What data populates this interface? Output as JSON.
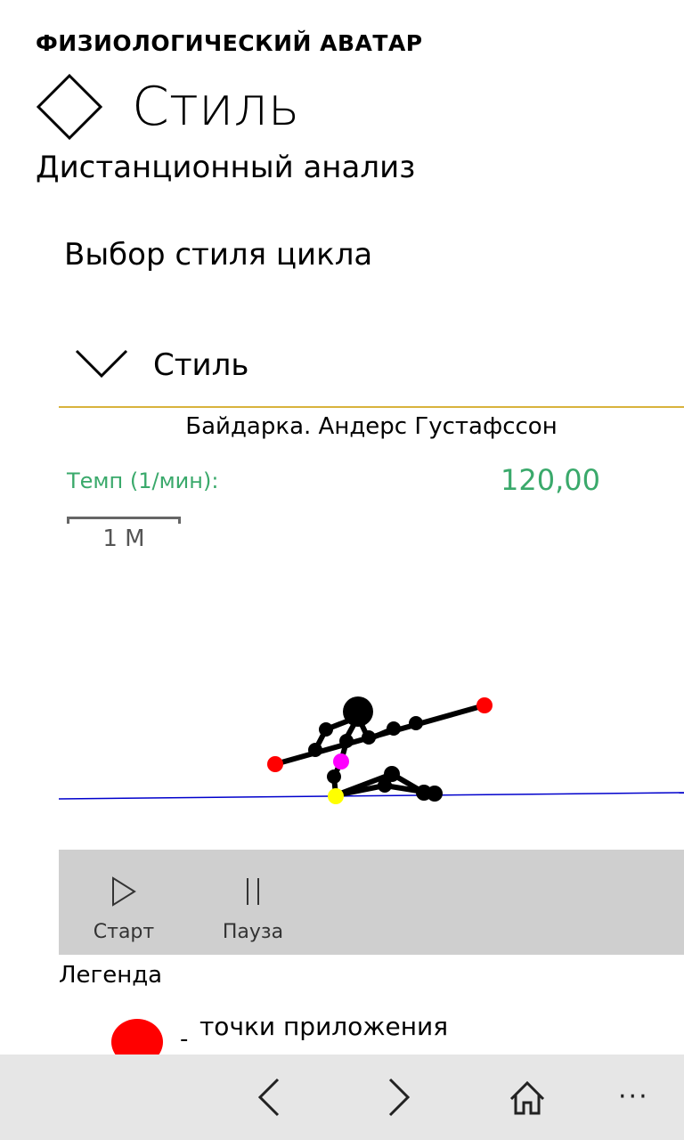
{
  "header": {
    "app_name": "ФИЗИОЛОГИЧЕСКИЙ АВАТАР",
    "page_title": "Стиль",
    "page_subtitle": "Дистанционный анализ",
    "page_icon": "diamond-icon"
  },
  "section": {
    "heading": "Выбор стиля цикла"
  },
  "expander": {
    "label": "Стиль",
    "icon": "chevron-down-icon",
    "accent_color": "#d8b33c"
  },
  "style_info": {
    "name": "Байдарка. Андерс Густафссон",
    "tempo_label": "Темп (1/мин):",
    "tempo_value": "120,00",
    "tempo_color": "#3aa96b"
  },
  "scale": {
    "label": "1 M"
  },
  "avatar_colors": {
    "body": "#000000",
    "application_points": "#ff0000",
    "center_of_mass": "#ff00ff",
    "support_point": "#ffff00",
    "water_line": "#0000cc"
  },
  "toolbar": {
    "start_label": "Старт",
    "start_icon": "play-icon",
    "pause_label": "Пауза",
    "pause_icon": "pause-icon"
  },
  "legend": {
    "title": "Легенда",
    "items": [
      {
        "marker_color": "#ff0000",
        "dash": "-",
        "text": "точки приложения"
      }
    ]
  },
  "app_bar": {
    "buttons": [
      "back-icon",
      "forward-icon",
      "home-icon",
      "more-icon"
    ],
    "more_glyph": "···"
  }
}
